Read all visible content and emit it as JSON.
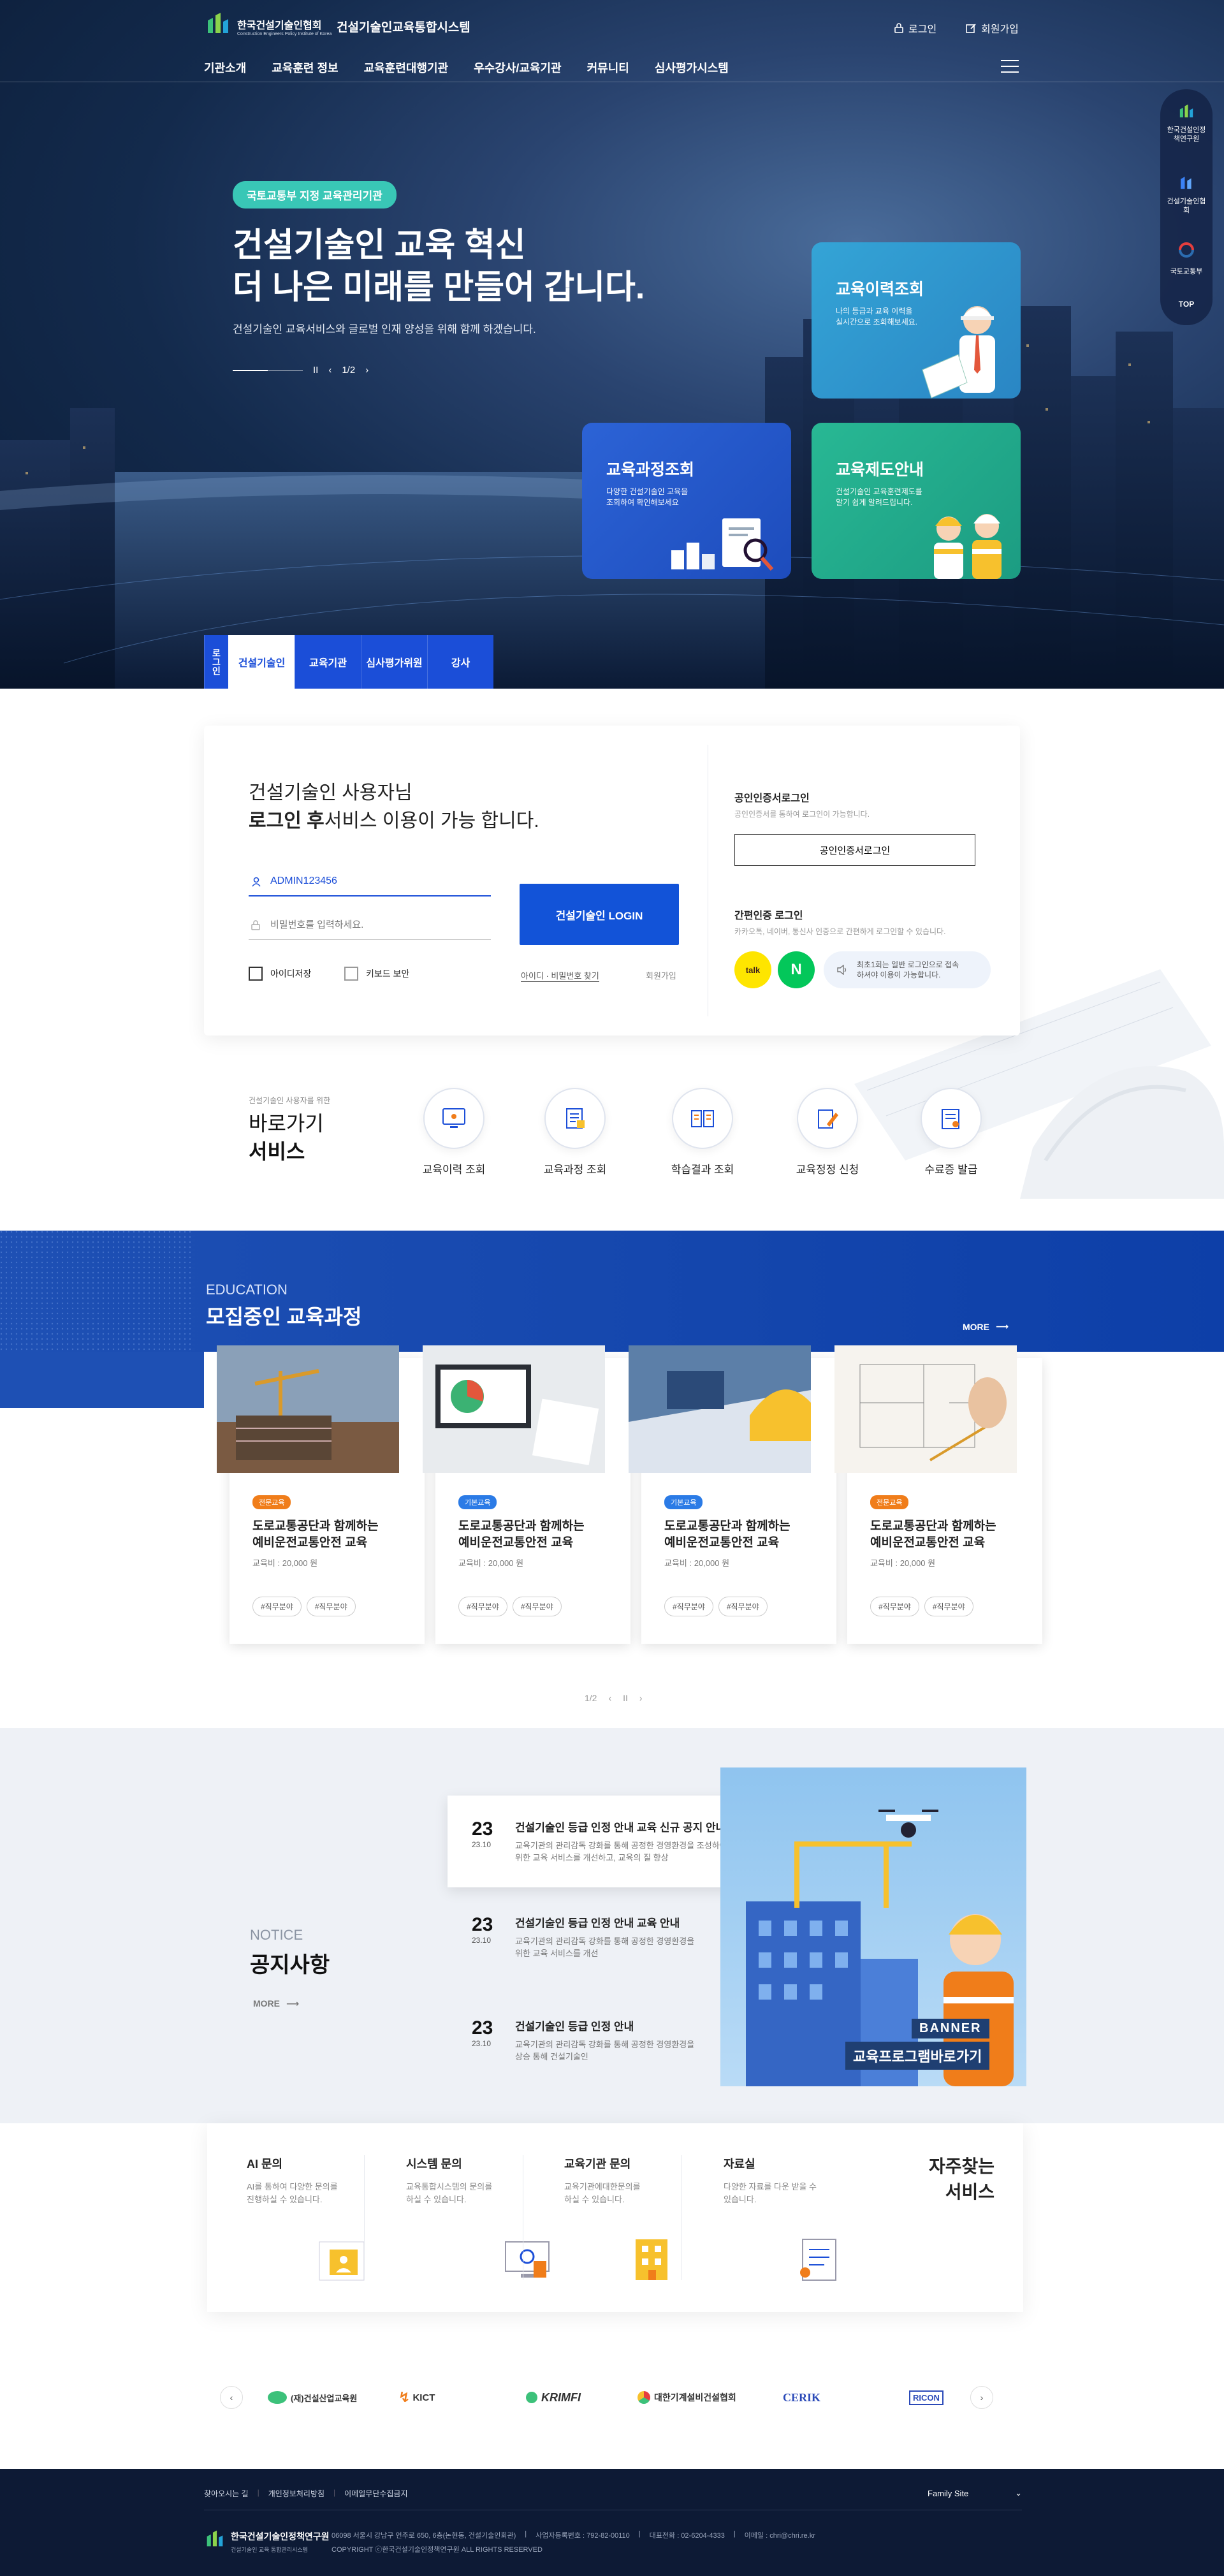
{
  "header": {
    "org_name": "한국건설기술인협회",
    "org_sub": "Construction Engineers Policy Institute of Korea",
    "system_name": "건설기술인교육통합시스템",
    "login": "로그인",
    "signup": "회원가입"
  },
  "gnb": [
    "기관소개",
    "교육훈련 정보",
    "교육훈련대행기관",
    "우수강사/교육기관",
    "커뮤니티",
    "심사평가시스템"
  ],
  "hero": {
    "badge": "국토교통부 지정 교육관리기관",
    "title_line1": "건설기술인 교육 혁신",
    "title_line2": "더 나은 미래를 만들어 갑니다.",
    "subtitle": "건설기술인 교육서비스와 글로벌 인재 양성을 위해 함께 하겠습니다.",
    "pause": "II",
    "page": "1/2"
  },
  "cards": [
    {
      "title": "교육이력조회",
      "desc1": "나의 등급과 교육 이력을",
      "desc2": "실시간으로 조회해보세요."
    },
    {
      "title": "교육과정조회",
      "desc1": "다양한 건설기술인 교육을",
      "desc2": "조회하여 확인해보세요"
    },
    {
      "title": "교육제도안내",
      "desc1": "건설기술인 교육훈련제도를",
      "desc2": "알기 쉽게 알려드립니다."
    }
  ],
  "quick_menu": {
    "item1": "한국건설인정책연구원",
    "item2": "건설기술인협회",
    "item3": "국토교통부",
    "top": "TOP"
  },
  "login_tabs": {
    "head": "로그인",
    "tabs": [
      "건설기술인",
      "교육기관",
      "심사평가위원",
      "강사"
    ]
  },
  "login": {
    "greet1": "건설기술인 사용자님",
    "greet_bold": "로그인 후",
    "greet2": "서비스 이용이 가능 합니다.",
    "id_value": "ADMIN123456",
    "pw_placeholder": "비밀번호를 입력하세요.",
    "btn": "건설기술인 LOGIN",
    "save_id": "아이디저장",
    "keyboard": "키보드 보안",
    "find": "아이디 · 비밀번호 찾기",
    "join": "회원가입",
    "cert_title": "공인인증서로그인",
    "cert_desc": "공인인증서를 통하여 로그인이 가능합니다.",
    "cert_btn": "공인인증서로그인",
    "easy_title": "간편인증 로그인",
    "easy_desc": "카카오톡, 네이버, 통신사 인증으로 간편하게 로그인할 수 있습니다.",
    "kakao": "talk",
    "naver": "N",
    "notice1": "최초1회는 일반 로그인으로 접속",
    "notice2": "하셔야 이용이 가능합니다."
  },
  "quick_service": {
    "small": "건설기술인 사용자를 위한",
    "title1": "바로가기",
    "title2": "서비스",
    "items": [
      "교육이력 조회",
      "교육과정 조회",
      "학습결과 조회",
      "교육정정 신청",
      "수료증 발급"
    ]
  },
  "education": {
    "eng": "EDUCATION",
    "title": "모집중인 교육과정",
    "more": "MORE",
    "courses": [
      {
        "tag": "전문교육",
        "tag_color": "#f07d1a",
        "title1": "도로교통공단과 함께하는",
        "title2": "예비운전교통안전 교육",
        "price": "교육비 : 20,000 원",
        "h1": "#직무분야",
        "h2": "#직무분야"
      },
      {
        "tag": "기본교육",
        "tag_color": "#2b7be6",
        "title1": "도로교통공단과 함께하는",
        "title2": "예비운전교통안전 교육",
        "price": "교육비 : 20,000 원",
        "h1": "#직무분야",
        "h2": "#직무분야"
      },
      {
        "tag": "기본교육",
        "tag_color": "#2b7be6",
        "title1": "도로교통공단과 함께하는",
        "title2": "예비운전교통안전 교육",
        "price": "교육비 : 20,000 원",
        "h1": "#직무분야",
        "h2": "#직무분야"
      },
      {
        "tag": "전문교육",
        "tag_color": "#f07d1a",
        "title1": "도로교통공단과 함께하는",
        "title2": "예비운전교통안전 교육",
        "price": "교육비 : 20,000 원",
        "h1": "#직무분야",
        "h2": "#직무분야"
      }
    ],
    "page": "1/2",
    "pause": "II"
  },
  "notice": {
    "eng": "NOTICE",
    "title": "공지사항",
    "more": "MORE",
    "items": [
      {
        "day": "23",
        "month": "23.10",
        "title": "건설기술인 등급 인정 안내 교육 신규 공지 안내",
        "desc1": "교육기관의 관리감독 강화를 통해 공정한 경영환경을 조성하여",
        "desc2": "위한 교육 서비스를 개선하고, 교육의 질 향상"
      },
      {
        "day": "23",
        "month": "23.10",
        "title": "건설기술인 등급 인정 안내 교육 안내",
        "desc1": "교육기관의 관리감독 강화를 통해 공정한 경영환경을",
        "desc2": "위한 교육 서비스를 개선"
      },
      {
        "day": "23",
        "month": "23.10",
        "title": "건설기술인 등급 인정 안내",
        "desc1": "교육기관의 관리감독 강화를 통해 공정한 경영환경을",
        "desc2": "상승 통해 건설기술인"
      }
    ],
    "banner_label": "BANNER",
    "banner_title": "교육프로그램바로가기"
  },
  "faq": {
    "title1": "자주찾는",
    "title2": "서비스",
    "cols": [
      {
        "title": "AI 문의",
        "d1": "AI를 통하여 다양한 문의를",
        "d2": "진행하실 수 있습니다."
      },
      {
        "title": "시스템 문의",
        "d1": "교육통합시스템의 문의를",
        "d2": "하실 수 있습니다."
      },
      {
        "title": "교육기관 문의",
        "d1": "교육기관에대한문의를",
        "d2": "하실 수 있습니다."
      },
      {
        "title": "자료실",
        "d1": "다양한 자료를 다운 받을 수",
        "d2": "있습니다."
      }
    ]
  },
  "partners": [
    "(재)건설산업교육원",
    "KICT",
    "KRIMFI",
    "대한기계설비건설협회",
    "CERIK",
    "RICON"
  ],
  "footer": {
    "links": [
      "찾아오시는 길",
      "개인정보처리방침",
      "이메일무단수집금지"
    ],
    "family": "Family Site",
    "org": "한국건설기술인정책연구원",
    "org_sub": "건설기술인 교육 통합관리시스템",
    "address": "06098 서울시 강남구 언주로 650, 6층(논현동, 건설기술인회관)",
    "bizno": "사업자등록번호 : 792-82-00110",
    "tel": "대표전화 : 02-6204-4333",
    "email": "이메일 : chri@chri.re.kr",
    "copyright": "COPYRIGHT ⓒ한국건설기술인정책연구원 ALL RIGHTS RESERVED"
  }
}
